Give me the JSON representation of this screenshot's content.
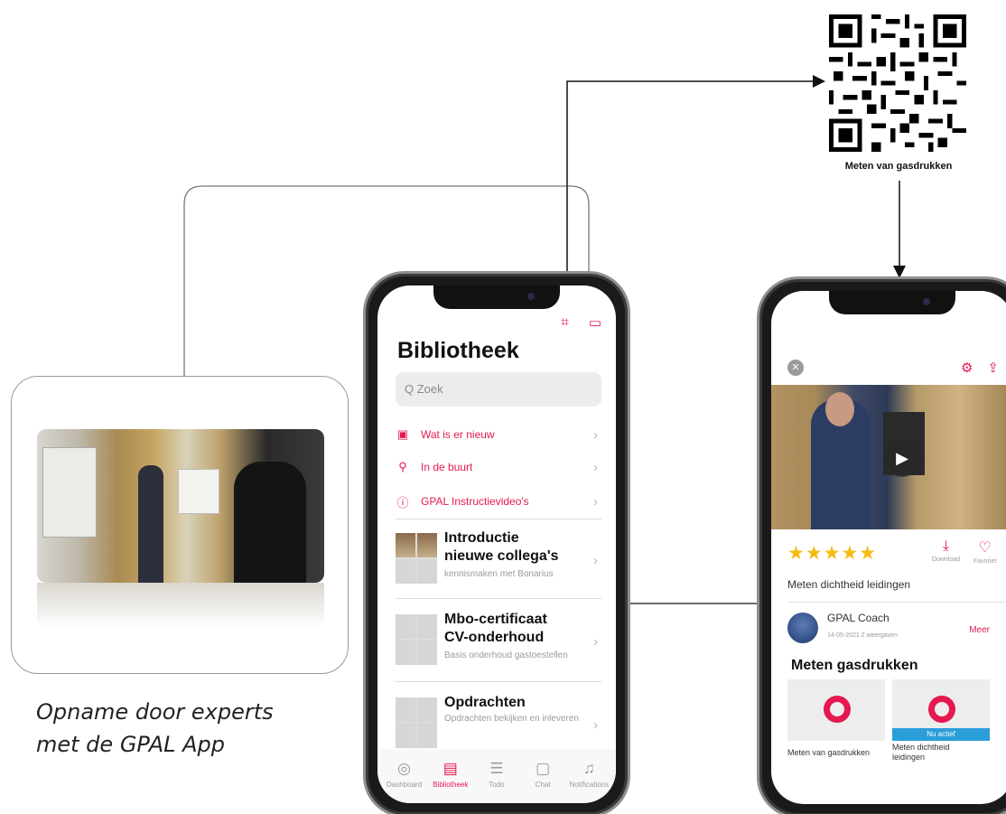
{
  "caption": {
    "line1": "Opname door experts",
    "line2": "met de GPAL App"
  },
  "qr": {
    "label": "Meten van gasdrukken"
  },
  "phone1": {
    "title": "Bibliotheek",
    "top_icons": [
      "qr-scan-icon",
      "video-camera-icon"
    ],
    "search_placeholder": "Q Zoek",
    "links": [
      {
        "icon": "play-square-icon",
        "label": "Wat is er nieuw"
      },
      {
        "icon": "location-pin-icon",
        "label": "In de buurt"
      },
      {
        "icon": "info-circle-icon",
        "label": "GPAL Instructievideo's"
      }
    ],
    "items": [
      {
        "title_line1": "Introductie",
        "title_line2": "nieuwe collega's",
        "subtitle": "kennismaken met Bonarius"
      },
      {
        "title_line1": "Mbo-certificaat",
        "title_line2": "CV-onderhoud",
        "subtitle": "Basis onderhoud gastoestellen"
      },
      {
        "title_line1": "Opdrachten",
        "title_line2": "",
        "subtitle": "Opdrachten bekijken en inleveren"
      }
    ],
    "tabs": [
      {
        "icon": "dashboard-icon",
        "label": "Dashboard",
        "active": false
      },
      {
        "icon": "library-icon",
        "label": "Bibliotheek",
        "active": true
      },
      {
        "icon": "todo-icon",
        "label": "Todo",
        "active": false
      },
      {
        "icon": "chat-icon",
        "label": "Chat",
        "active": false
      },
      {
        "icon": "bell-icon",
        "label": "Notifications",
        "active": false
      }
    ]
  },
  "phone2": {
    "rating_stars": 5,
    "download_label": "Download",
    "favoriet_label": "Favoriet",
    "description": "Meten dichtheid leidingen",
    "author": "GPAL Coach",
    "meta": "14-05-2021   2 weergaven",
    "more_label": "Meer",
    "section_title": "Meten gasdrukken",
    "cards": [
      {
        "caption": "Meten van gasdrukken",
        "badge": ""
      },
      {
        "caption_line1": "Meten dichtheid",
        "caption_line2": "leidingen",
        "badge": "Nu actief"
      }
    ]
  },
  "colors": {
    "accent": "#e5194f",
    "star": "#f6bb0f",
    "badge": "#2b9ed9"
  }
}
